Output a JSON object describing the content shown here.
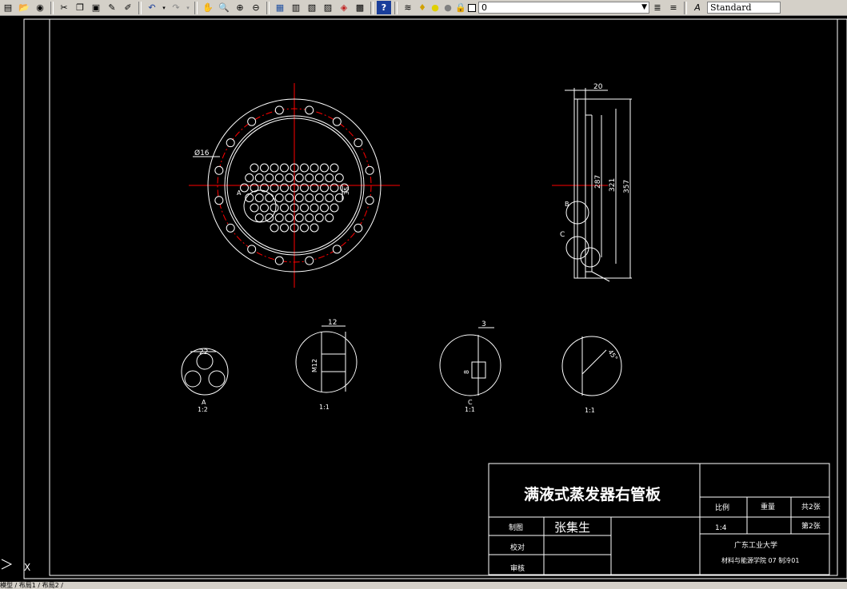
{
  "toolbar": {
    "layer_value": "0",
    "style_value": "Standard",
    "icons": [
      "new-icon",
      "open-icon",
      "save-icon",
      "cut-icon",
      "copy-icon",
      "paste-icon",
      "match-properties-icon",
      "brush-icon",
      "undo-icon",
      "redo-icon",
      "pan-icon",
      "zoom-realtime-icon",
      "zoom-window-icon",
      "zoom-previous-icon",
      "properties-icon",
      "design-center-icon",
      "tool-palette-icon",
      "sheet-set-icon",
      "markup-icon",
      "calculator-icon",
      "help-icon",
      "layer-manager-icon",
      "bulb-icon",
      "sun-icon",
      "lock-icon",
      "color-square-icon",
      "make-current-icon",
      "layer-previous-icon",
      "text-style-icon"
    ]
  },
  "drawing": {
    "dims": {
      "top_width": "20",
      "d287": "287",
      "d321": "321",
      "d357": "357",
      "phi16": "Ø16",
      "d35": "35",
      "label_a_main": "A",
      "label_b": "B",
      "label_c_side": "C",
      "d22": "22",
      "d12": "12",
      "m12": "M12",
      "d3": "3",
      "d8": "8",
      "d45": "45°"
    },
    "details": [
      {
        "label": "A",
        "scale": "1:2"
      },
      {
        "label": "",
        "scale": "1:1"
      },
      {
        "label": "C",
        "scale": "1:1"
      },
      {
        "label": "",
        "scale": "1:1"
      }
    ]
  },
  "title_block": {
    "title": "满液式蒸发器右管板",
    "ratio_label": "比例",
    "weight_label": "重量",
    "total_sheets": "共2张",
    "ratio_value": "1:4",
    "sheet_no": "第2张",
    "drawn_label": "制图",
    "drawn_name": "张集生",
    "check_label": "校对",
    "review_label": "审核",
    "university": "广东工业大学",
    "department": "材料与能源学院 07 制冷01"
  },
  "statusbar": {
    "tabs_text": "模型 / 布局1 / 布局2 /"
  },
  "colors": {
    "centerline": "#ff0000",
    "geometry": "#ffffff",
    "background": "#000000",
    "toolbar": "#d4d0c8"
  }
}
